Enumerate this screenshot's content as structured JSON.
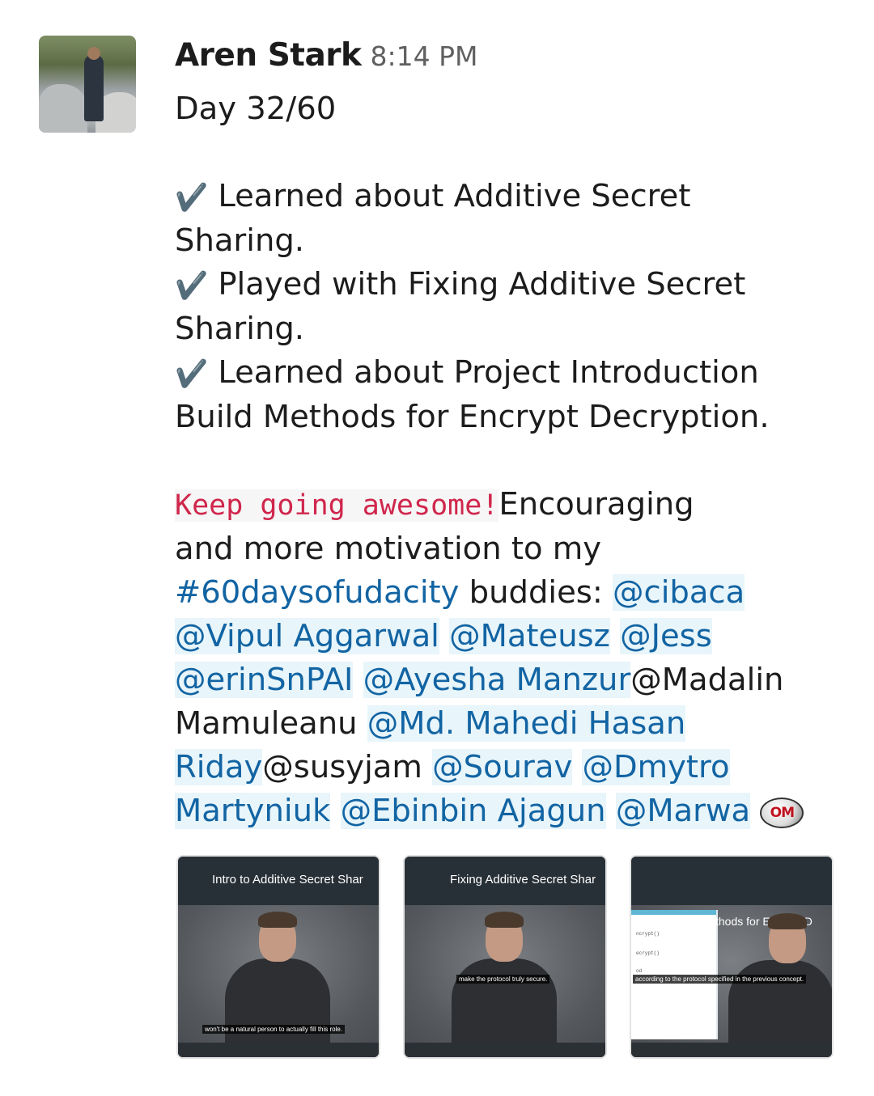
{
  "message": {
    "author": "Aren Stark",
    "time": "8:14 PM",
    "avatar_alt": "avatar",
    "day": "Day 32/60",
    "check_icon": "✔️",
    "items": [
      {
        "line1": "Learned about Additive Secret",
        "line2": "Sharing."
      },
      {
        "line1": "Played with Fixing Additive Secret",
        "line2": "Sharing."
      },
      {
        "line1": "Learned about Project Introduction",
        "line2": "Build Methods for Encrypt Decryption."
      }
    ],
    "code_text": "Keep going awesome!",
    "after_code": "Encouraging",
    "line_motivation": "and more motivation to my",
    "hashtag": "#60daysofudacity",
    "buddies_label": " buddies: ",
    "mentions": {
      "cibaca": "@cibaca",
      "vipul": "@Vipul Aggarwal",
      "mateusz": "@Mateusz",
      "jess": "@Jess",
      "erin": "@erinSnPAI",
      "ayesha": "@Ayesha Manzur",
      "madalin_a": "@Madalin",
      "madalin_b": "Mamuleanu",
      "mahedi_a": "@Md. Mahedi Hasan",
      "mahedi_b": "Riday",
      "susyjam": "@susyjam",
      "sourav": "@Sourav",
      "dmytro_a": "@Dmytro",
      "dmytro_b": "Martyniuk",
      "ebinbin": "@Ebinbin Ajagun",
      "marwa": "@Marwa"
    },
    "badge_text": "OM"
  },
  "attachments": [
    {
      "title": "Intro to Additive Secret Shar",
      "caption": "won't be a natural person to actually fill this role."
    },
    {
      "title": "Fixing Additive Secret Shar",
      "caption": "make the protocol truly secure."
    },
    {
      "title": "thods for Encrypt D",
      "caption": "according to the protocol specified in the previous concept.",
      "panel_lines": [
        "ncrypt()",
        "ecrypt()",
        "od"
      ]
    }
  ],
  "colors": {
    "link": "#1264a3",
    "mention_bg": "#e8f5fa",
    "code": "#d0264c"
  }
}
